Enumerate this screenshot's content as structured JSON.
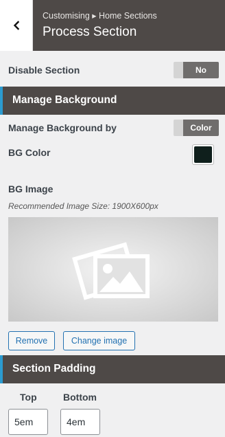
{
  "header": {
    "breadcrumb": "Customising ▸ Home Sections",
    "title": "Process Section"
  },
  "disable_section": {
    "label": "Disable Section",
    "value": "No"
  },
  "manage_background": {
    "title": "Manage Background",
    "by_label": "Manage Background by",
    "by_value": "Color",
    "bg_color_label": "BG Color",
    "bg_color": "#0f1f1c",
    "bg_image_label": "BG Image",
    "recommended_size": "Recommended Image Size: 1900X600px",
    "remove_label": "Remove",
    "change_label": "Change image"
  },
  "section_padding": {
    "title": "Section Padding",
    "top_label": "Top",
    "bottom_label": "Bottom",
    "top_value": "5em",
    "bottom_value": "4em"
  },
  "colors": {
    "accent": "#2b9bd0",
    "header_bg": "#4e4947",
    "link": "#2271b1"
  }
}
